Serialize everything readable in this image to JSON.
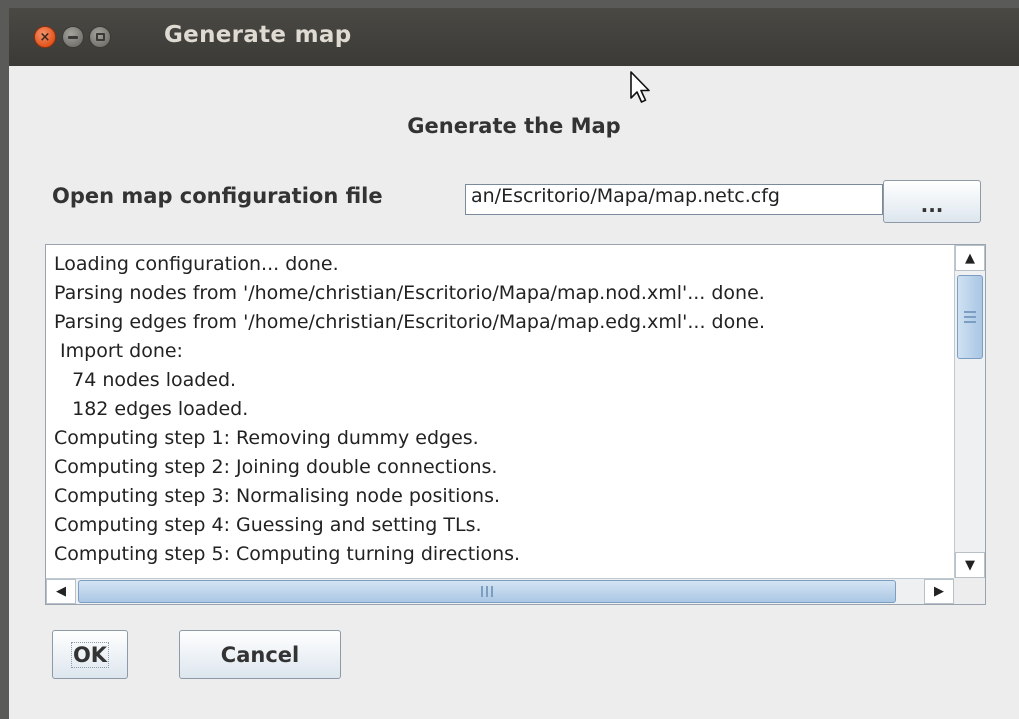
{
  "window": {
    "title": "Generate map"
  },
  "dialog": {
    "heading": "Generate the Map",
    "config_label": "Open map configuration file",
    "config_value": "an/Escritorio/Mapa/map.netc.cfg",
    "browse_label": "...",
    "log_lines": [
      "Loading configuration... done.",
      "Parsing nodes from '/home/christian/Escritorio/Mapa/map.nod.xml'... done.",
      "Parsing edges from '/home/christian/Escritorio/Mapa/map.edg.xml'... done.",
      " Import done:",
      "   74 nodes loaded.",
      "   182 edges loaded.",
      "Computing step 1: Removing dummy edges.",
      "Computing step 2: Joining double connections.",
      "Computing step 3: Normalising node positions.",
      "Computing step 4: Guessing and setting TLs.",
      "Computing step 5: Computing turning directions."
    ],
    "ok_label": "OK",
    "cancel_label": "Cancel"
  },
  "icons": {
    "close": "close-icon",
    "minimize": "minimize-icon",
    "maximize": "maximize-icon",
    "pointer": "mouse-pointer-icon"
  },
  "colors": {
    "titlebar": "#3c3b37",
    "close_button": "#e95420",
    "window_bg": "#ededed",
    "scroll_thumb": "#b8d1ea"
  }
}
